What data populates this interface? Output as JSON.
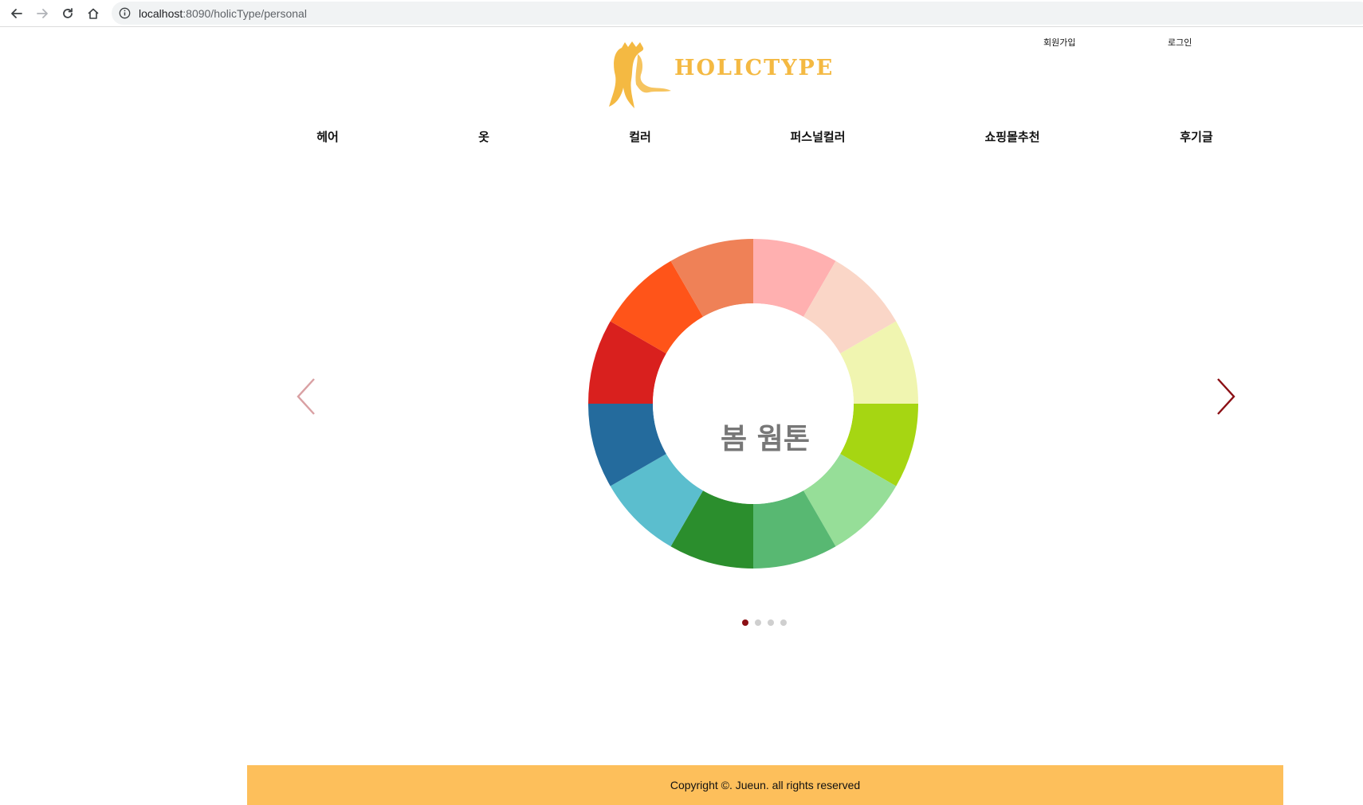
{
  "browser": {
    "url_host": "localhost",
    "url_rest": ":8090/holicType/personal"
  },
  "header": {
    "signup_label": "회원가입",
    "login_label": "로그인",
    "logo_text": "HOLICTYPE",
    "logo_color": "#f4b942"
  },
  "menu": {
    "items": [
      {
        "label": "헤어"
      },
      {
        "label": "옷"
      },
      {
        "label": "컬러"
      },
      {
        "label": "퍼스널컬러"
      },
      {
        "label": "쇼핑몰추천"
      },
      {
        "label": "후기글"
      }
    ]
  },
  "carousel": {
    "slide_title": "봄 웜톤",
    "wheel_colors": [
      "#ffb0b0",
      "#fad6c7",
      "#f0f5b0",
      "#a6d612",
      "#96de98",
      "#58b872",
      "#2b8e2d",
      "#5bbece",
      "#246b9d",
      "#d9201e",
      "#ff5419",
      "#ef8157"
    ],
    "prev_arrow_color": "#d9a0a3",
    "next_arrow_color": "#8b0f14",
    "dots": [
      {
        "active": true
      },
      {
        "active": false
      },
      {
        "active": false
      },
      {
        "active": false
      }
    ]
  },
  "footer": {
    "copyright": "Copyright ©. Jueun. all rights reserved",
    "background": "#fdbf5b"
  }
}
